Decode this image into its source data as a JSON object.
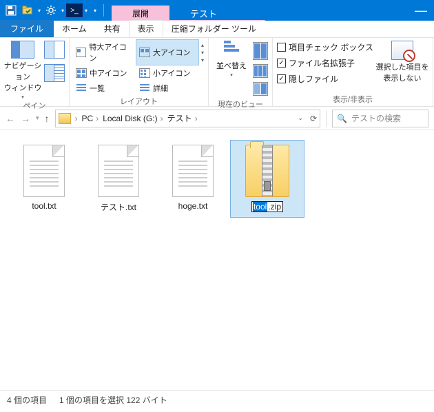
{
  "title_context_tab": "展開",
  "title_app": "テスト",
  "qat": {
    "save": "save",
    "folder_check": "folder-check",
    "gear": "settings",
    "powershell": ">_"
  },
  "ribbon_tabs": {
    "file": "ファイル",
    "home": "ホーム",
    "share": "共有",
    "view": "表示",
    "ctx": "圧縮フォルダー ツール"
  },
  "ribbon": {
    "panes_group": "ペイン",
    "nav_pane": "ナビゲーション\nウィンドウ",
    "layout_group": "レイアウト",
    "layout": {
      "xl_icons": "特大アイコン",
      "l_icons": "大アイコン",
      "m_icons": "中アイコン",
      "s_icons": "小アイコン",
      "list": "一覧",
      "details": "詳細"
    },
    "currentview_group": "現在のビュー",
    "sort": "並べ替え",
    "showhide_group": "表示/非表示",
    "chk_boxes": "項目チェック ボックス",
    "file_ext": "ファイル名拡張子",
    "hidden": "隠しファイル",
    "hide_selected": "選択した項目を\n表示しない"
  },
  "breadcrumb": {
    "pc": "PC",
    "disk": "Local Disk (G:)",
    "folder": "テスト"
  },
  "search_placeholder": "テストの検索",
  "files": [
    {
      "name": "tool.txt"
    },
    {
      "name": "テスト.txt"
    },
    {
      "name": "hoge.txt"
    },
    {
      "name_base": "tool",
      "name_ext": ".zip",
      "selected": true,
      "renaming": true,
      "zip": true
    }
  ],
  "status": {
    "count": "4 個の項目",
    "selection": "1 個の項目を選択 122 バイト"
  }
}
